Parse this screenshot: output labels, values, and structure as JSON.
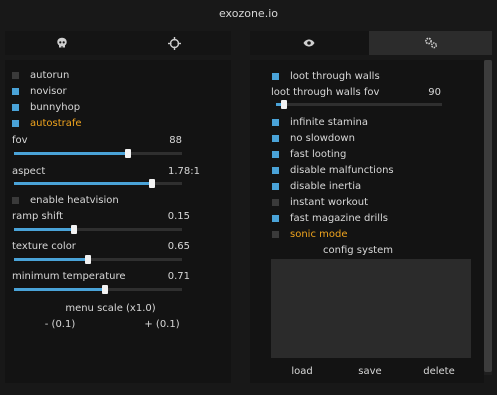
{
  "title": "exozone.io",
  "tabs": [
    {
      "icon": "skull-icon",
      "active": false
    },
    {
      "icon": "crosshair-icon",
      "active": false
    },
    {
      "icon": "eye-icon",
      "active": false
    },
    {
      "icon": "gear-icon",
      "active": true
    }
  ],
  "left": {
    "toggles": [
      {
        "label": "autorun",
        "checked": false
      },
      {
        "label": "novisor",
        "checked": true
      },
      {
        "label": "bunnyhop",
        "checked": true
      },
      {
        "label": "autostrafe",
        "checked": true,
        "accent": true
      }
    ],
    "fov": {
      "label": "fov",
      "value": "88",
      "fraction": 0.68
    },
    "aspect": {
      "label": "aspect",
      "value": "1.78:1",
      "fraction": 0.82
    },
    "heatvision": {
      "label": "enable heatvision",
      "checked": false
    },
    "ramp_shift": {
      "label": "ramp shift",
      "value": "0.15",
      "fraction": 0.36
    },
    "texture_color": {
      "label": "texture color",
      "value": "0.65",
      "fraction": 0.44
    },
    "min_temp": {
      "label": "minimum temperature",
      "value": "0.71",
      "fraction": 0.54
    },
    "menu_scale": {
      "label": "menu scale (x1.0)",
      "minus": "- (0.1)",
      "plus": "+ (0.1)"
    }
  },
  "right": {
    "loot_walls": {
      "label": "loot through walls",
      "checked": true
    },
    "loot_fov": {
      "label": "loot through walls fov",
      "value": "90",
      "fraction": 0.05
    },
    "toggles": [
      {
        "label": "infinite stamina",
        "checked": true
      },
      {
        "label": "no slowdown",
        "checked": true
      },
      {
        "label": "fast looting",
        "checked": true
      },
      {
        "label": "disable malfunctions",
        "checked": true
      },
      {
        "label": "disable inertia",
        "checked": true
      },
      {
        "label": "instant workout",
        "checked": false
      },
      {
        "label": "fast magazine drills",
        "checked": true
      },
      {
        "label": "sonic mode",
        "checked": false,
        "accent": true
      }
    ],
    "config": {
      "title": "config system",
      "load": "load",
      "save": "save",
      "delete": "delete"
    }
  },
  "colors": {
    "accent": "#f0a41e",
    "checkbox_on": "#4aa3d8",
    "checkbox_off": "#3a3a3a"
  }
}
